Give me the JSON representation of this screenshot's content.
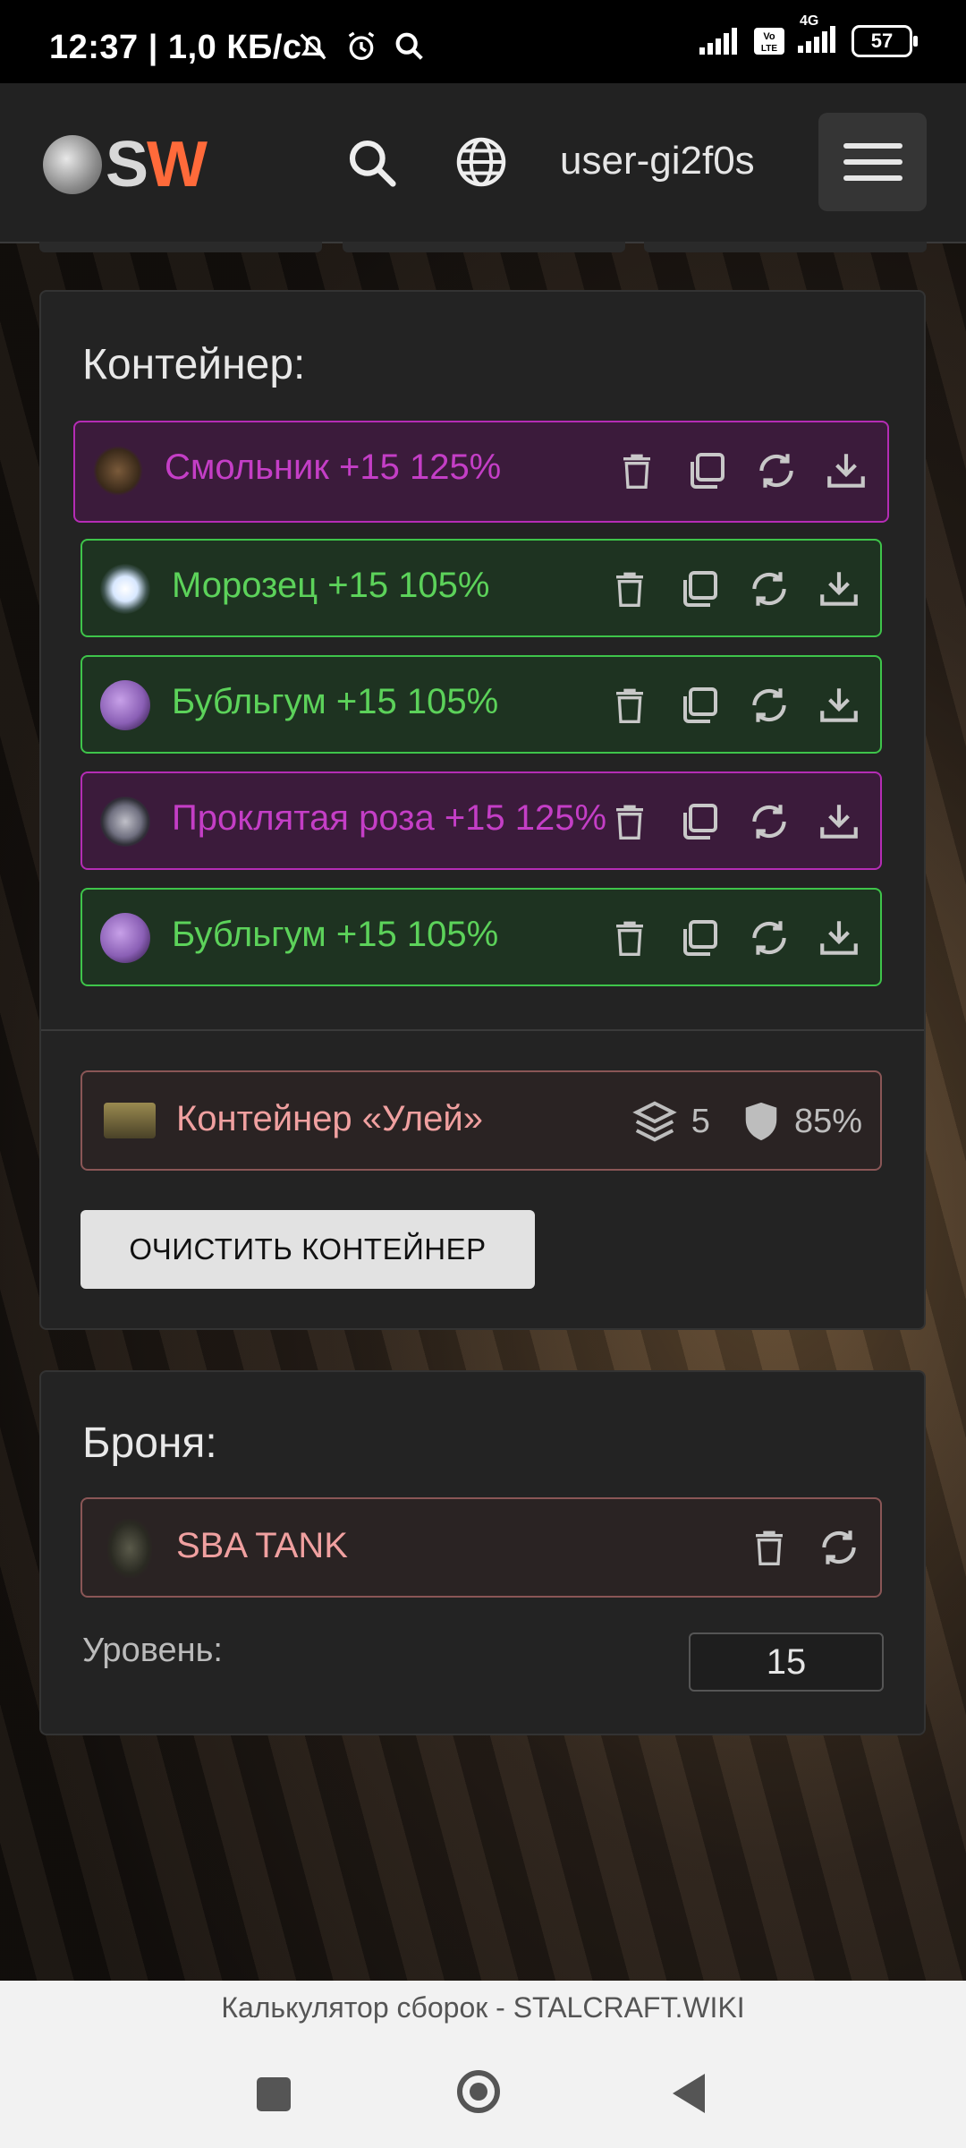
{
  "status_bar": {
    "time": "12:37 | 1,0 КБ/с",
    "battery": "57",
    "network": "4G",
    "icons": [
      "mute-bell-icon",
      "alarm-icon",
      "search-icon",
      "signal-icon",
      "volte-icon",
      "signal-icon",
      "battery-icon"
    ]
  },
  "header": {
    "logo_s": "S",
    "logo_w": "W",
    "username": "user-gi2f0s",
    "icons": [
      "search-icon",
      "globe-icon",
      "hamburger-menu-icon"
    ],
    "accent_color": "#ff6a3a"
  },
  "container_section": {
    "title": "Контейнер:",
    "slots": [
      {
        "name": "Смольник +15 125%",
        "rarity": "purple"
      },
      {
        "name": "Морозец +15 105%",
        "rarity": "green"
      },
      {
        "name": "Бубльгум +15 105%",
        "rarity": "green"
      },
      {
        "name": "Проклятая роза +15 125%",
        "rarity": "purple"
      },
      {
        "name": "Бубльгум +15 105%",
        "rarity": "green"
      }
    ],
    "slot_actions": [
      "trash-icon",
      "copy-icon",
      "swap-icon",
      "download-icon"
    ],
    "container": {
      "name": "Контейнер «Улей»",
      "capacity": "5",
      "protection": "85%"
    },
    "clear_button": "ОЧИСТИТЬ КОНТЕЙНЕР"
  },
  "armor_section": {
    "title": "Броня:",
    "armor_name": "SBA TANK",
    "level_label": "Уровень:",
    "level_value": "15"
  },
  "footer": {
    "page_title": "Калькулятор сборок - STALCRAFT.WIKI"
  },
  "colors": {
    "purple_rarity": "#c43ec6",
    "green_rarity": "#5cd25a",
    "container_text": "#f0a0a0"
  }
}
